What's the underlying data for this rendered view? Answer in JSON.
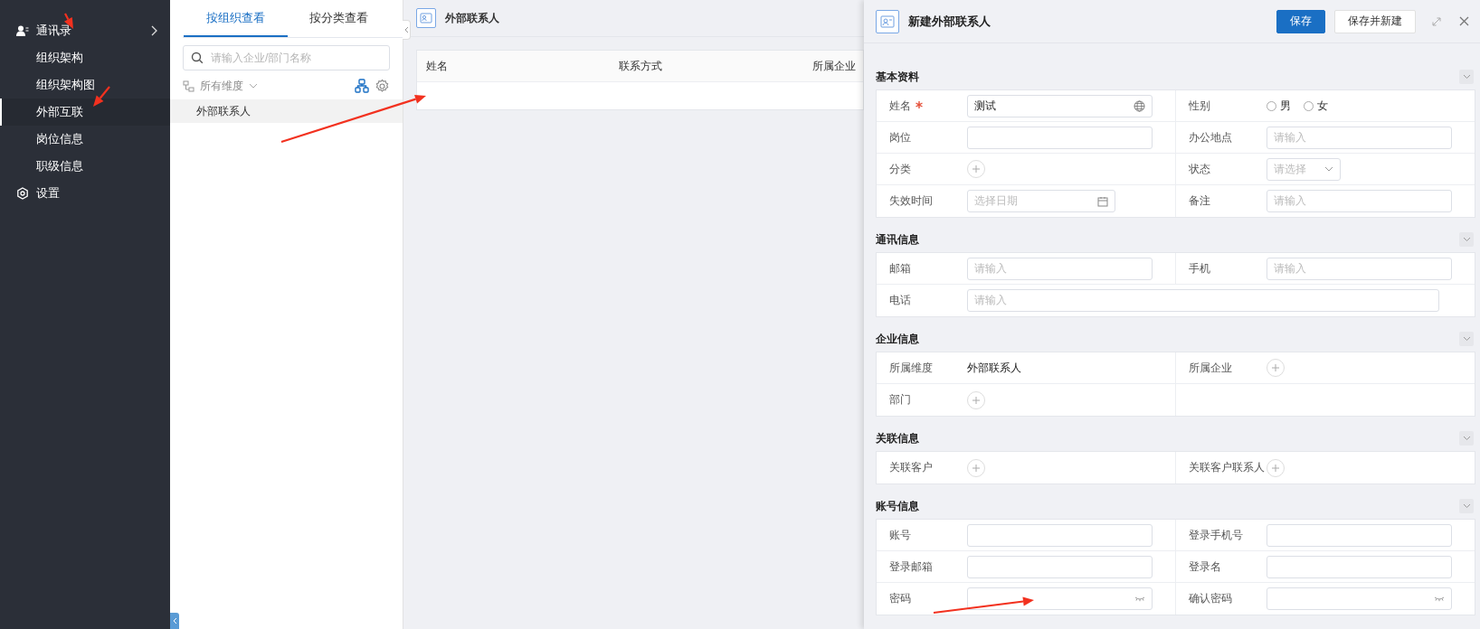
{
  "sidebar": {
    "items": [
      {
        "label": "通讯录",
        "kind": "group",
        "selected": false
      },
      {
        "label": "组织架构",
        "kind": "item",
        "selected": false
      },
      {
        "label": "组织架构图",
        "kind": "item",
        "selected": false
      },
      {
        "label": "外部互联",
        "kind": "item",
        "selected": true
      },
      {
        "label": "岗位信息",
        "kind": "item",
        "selected": false
      },
      {
        "label": "职级信息",
        "kind": "item",
        "selected": false
      },
      {
        "label": "设置",
        "kind": "setting",
        "selected": false
      }
    ]
  },
  "org_panel": {
    "tabs": [
      {
        "label": "按组织查看",
        "selected": true
      },
      {
        "label": "按分类查看",
        "selected": false
      }
    ],
    "search": {
      "placeholder": "请输入企业/部门名称"
    },
    "dimension": "所有维度",
    "tree": [
      {
        "label": "外部联系人",
        "selected": true
      }
    ]
  },
  "list": {
    "title": "外部联系人",
    "columns": [
      "姓名",
      "联系方式",
      "所属企业"
    ]
  },
  "form": {
    "title": "新建外部联系人",
    "buttons": [
      {
        "label": "保存",
        "kind": "primary"
      },
      {
        "label": "保存并新建",
        "kind": "default"
      }
    ],
    "sections": [
      {
        "title": "基本资料",
        "fields": [
          {
            "label": "姓名",
            "kind": "multilang",
            "required": true,
            "value": "测试"
          },
          {
            "label": "性别",
            "kind": "radio",
            "options": [
              {
                "label": "男",
                "selected": false
              },
              {
                "label": "女",
                "selected": false
              }
            ]
          },
          {
            "label": "岗位",
            "kind": "input"
          },
          {
            "label": "办公地点",
            "kind": "input",
            "placeholder": "请输入"
          },
          {
            "label": "分类",
            "kind": "add"
          },
          {
            "label": "状态",
            "kind": "select",
            "placeholder": "请选择"
          },
          {
            "label": "失效时间",
            "kind": "date",
            "placeholder": "选择日期"
          },
          {
            "label": "备注",
            "kind": "input",
            "placeholder": "请输入"
          }
        ]
      },
      {
        "title": "通讯信息",
        "fields": [
          {
            "label": "邮箱",
            "kind": "input",
            "placeholder": "请输入"
          },
          {
            "label": "手机",
            "kind": "input",
            "placeholder": "请输入"
          },
          {
            "label": "电话",
            "kind": "input",
            "placeholder": "请输入",
            "wide": true
          }
        ]
      },
      {
        "title": "企业信息",
        "fields": [
          {
            "label": "所属维度",
            "kind": "text",
            "value": "外部联系人"
          },
          {
            "label": "所属企业",
            "kind": "add"
          },
          {
            "label": "部门",
            "kind": "add"
          }
        ]
      },
      {
        "title": "关联信息",
        "fields": [
          {
            "label": "关联客户",
            "kind": "add"
          },
          {
            "label": "关联客户联系人",
            "kind": "add"
          }
        ]
      },
      {
        "title": "账号信息",
        "fields": [
          {
            "label": "账号",
            "kind": "input"
          },
          {
            "label": "登录手机号",
            "kind": "input"
          },
          {
            "label": "登录邮箱",
            "kind": "input"
          },
          {
            "label": "登录名",
            "kind": "input"
          },
          {
            "label": "密码",
            "kind": "password"
          },
          {
            "label": "确认密码",
            "kind": "password"
          }
        ]
      }
    ]
  }
}
